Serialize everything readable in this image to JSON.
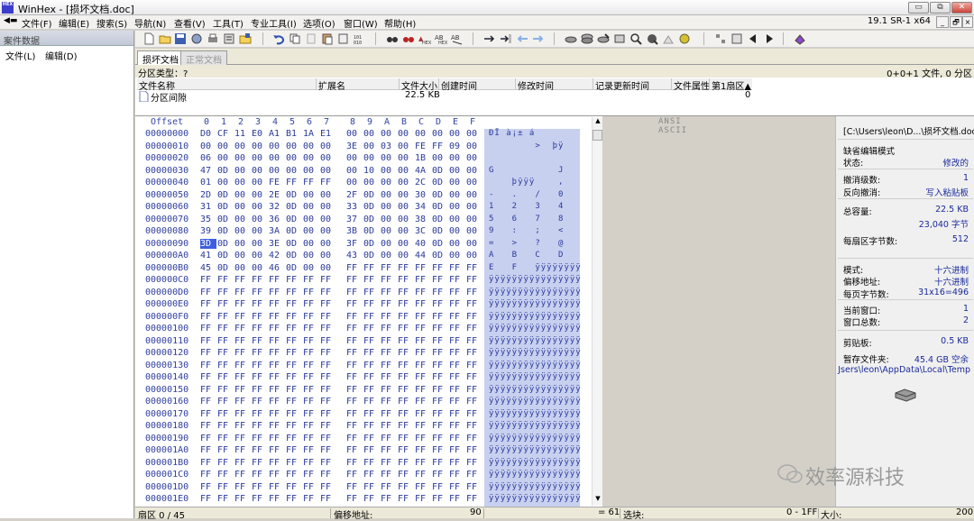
{
  "window": {
    "app_logo_text": "HEX",
    "title": "WinHex - [损坏文档.doc]",
    "version": "19.1 SR-1 x64",
    "controls": {
      "minimize": "▭",
      "restore": "⧉",
      "close": "✕"
    }
  },
  "menubar": {
    "items": [
      "文件(F)",
      "编辑(E)",
      "搜索(S)",
      "导航(N)",
      "查看(V)",
      "工具(T)",
      "专业工具(I)",
      "选项(O)",
      "窗口(W)",
      "帮助(H)"
    ],
    "mdi_controls": {
      "minimize": "_",
      "restore": "🗗",
      "close": "×"
    }
  },
  "left_pane": {
    "title": "案件数据",
    "menu": [
      "文件(L)",
      "编辑(D)"
    ]
  },
  "tabs": [
    {
      "label": "损坏文档",
      "active": true
    },
    {
      "label": "正常文档",
      "active": false
    }
  ],
  "info": {
    "partition_type": "分区类型：?",
    "file_summary": "0+0+1 文件, 0 分区"
  },
  "directory": {
    "columns": [
      "文件名称",
      "扩展名",
      "文件大小",
      "创建时间",
      "修改时间",
      "记录更新时间",
      "文件属性",
      "第1扇区▲"
    ],
    "rows": [
      {
        "name": "分区间隙",
        "ext": "",
        "size": "22.5 KB",
        "created": "",
        "modified": "",
        "updated": "",
        "attr": "",
        "sector": "0"
      }
    ]
  },
  "hex": {
    "offset_header": "Offset",
    "column_headers": [
      "0",
      "1",
      "2",
      "3",
      "4",
      "5",
      "6",
      "7",
      "8",
      "9",
      "A",
      "B",
      "C",
      "D",
      "E",
      "F"
    ],
    "ascii_header": "ANSI ASCII",
    "rows": [
      {
        "offset": "00000000",
        "bytes": [
          "D0",
          "CF",
          "11",
          "E0",
          "A1",
          "B1",
          "1A",
          "E1",
          "00",
          "00",
          "00",
          "00",
          "00",
          "00",
          "00",
          "00"
        ],
        "ascii": "ĐÏ à¡± á"
      },
      {
        "offset": "00000010",
        "bytes": [
          "00",
          "00",
          "00",
          "00",
          "00",
          "00",
          "00",
          "00",
          "3E",
          "00",
          "03",
          "00",
          "FE",
          "FF",
          "09",
          "00"
        ],
        "ascii": "        >  þÿ"
      },
      {
        "offset": "00000020",
        "bytes": [
          "06",
          "00",
          "00",
          "00",
          "00",
          "00",
          "00",
          "00",
          "00",
          "00",
          "00",
          "00",
          "1B",
          "00",
          "00",
          "00"
        ],
        "ascii": ""
      },
      {
        "offset": "00000030",
        "bytes": [
          "47",
          "0D",
          "00",
          "00",
          "00",
          "00",
          "00",
          "00",
          "00",
          "10",
          "00",
          "00",
          "4A",
          "0D",
          "00",
          "00"
        ],
        "ascii": "G           J"
      },
      {
        "offset": "00000040",
        "bytes": [
          "01",
          "00",
          "00",
          "00",
          "FE",
          "FF",
          "FF",
          "FF",
          "00",
          "00",
          "00",
          "00",
          "2C",
          "0D",
          "00",
          "00"
        ],
        "ascii": "    þÿÿÿ    ,"
      },
      {
        "offset": "00000050",
        "bytes": [
          "2D",
          "0D",
          "00",
          "00",
          "2E",
          "0D",
          "00",
          "00",
          "2F",
          "0D",
          "00",
          "00",
          "30",
          "0D",
          "00",
          "00"
        ],
        "ascii": "-   .   /   0"
      },
      {
        "offset": "00000060",
        "bytes": [
          "31",
          "0D",
          "00",
          "00",
          "32",
          "0D",
          "00",
          "00",
          "33",
          "0D",
          "00",
          "00",
          "34",
          "0D",
          "00",
          "00"
        ],
        "ascii": "1   2   3   4"
      },
      {
        "offset": "00000070",
        "bytes": [
          "35",
          "0D",
          "00",
          "00",
          "36",
          "0D",
          "00",
          "00",
          "37",
          "0D",
          "00",
          "00",
          "38",
          "0D",
          "00",
          "00"
        ],
        "ascii": "5   6   7   8"
      },
      {
        "offset": "00000080",
        "bytes": [
          "39",
          "0D",
          "00",
          "00",
          "3A",
          "0D",
          "00",
          "00",
          "3B",
          "0D",
          "00",
          "00",
          "3C",
          "0D",
          "00",
          "00"
        ],
        "ascii": "9   :   ;   <"
      },
      {
        "offset": "00000090",
        "bytes": [
          "3D",
          "0D",
          "00",
          "00",
          "3E",
          "0D",
          "00",
          "00",
          "3F",
          "0D",
          "00",
          "00",
          "40",
          "0D",
          "00",
          "00"
        ],
        "ascii": "=   >   ?   @"
      },
      {
        "offset": "000000A0",
        "bytes": [
          "41",
          "0D",
          "00",
          "00",
          "42",
          "0D",
          "00",
          "00",
          "43",
          "0D",
          "00",
          "00",
          "44",
          "0D",
          "00",
          "00"
        ],
        "ascii": "A   B   C   D"
      },
      {
        "offset": "000000B0",
        "bytes": [
          "45",
          "0D",
          "00",
          "00",
          "46",
          "0D",
          "00",
          "00",
          "FF",
          "FF",
          "FF",
          "FF",
          "FF",
          "FF",
          "FF",
          "FF"
        ],
        "ascii": "E   F   ÿÿÿÿÿÿÿÿ"
      },
      {
        "offset": "000000C0",
        "bytes": [
          "FF",
          "FF",
          "FF",
          "FF",
          "FF",
          "FF",
          "FF",
          "FF",
          "FF",
          "FF",
          "FF",
          "FF",
          "FF",
          "FF",
          "FF",
          "FF"
        ],
        "ascii": "ÿÿÿÿÿÿÿÿÿÿÿÿÿÿÿÿ"
      },
      {
        "offset": "000000D0",
        "bytes": [
          "FF",
          "FF",
          "FF",
          "FF",
          "FF",
          "FF",
          "FF",
          "FF",
          "FF",
          "FF",
          "FF",
          "FF",
          "FF",
          "FF",
          "FF",
          "FF"
        ],
        "ascii": "ÿÿÿÿÿÿÿÿÿÿÿÿÿÿÿÿ"
      },
      {
        "offset": "000000E0",
        "bytes": [
          "FF",
          "FF",
          "FF",
          "FF",
          "FF",
          "FF",
          "FF",
          "FF",
          "FF",
          "FF",
          "FF",
          "FF",
          "FF",
          "FF",
          "FF",
          "FF"
        ],
        "ascii": "ÿÿÿÿÿÿÿÿÿÿÿÿÿÿÿÿ"
      },
      {
        "offset": "000000F0",
        "bytes": [
          "FF",
          "FF",
          "FF",
          "FF",
          "FF",
          "FF",
          "FF",
          "FF",
          "FF",
          "FF",
          "FF",
          "FF",
          "FF",
          "FF",
          "FF",
          "FF"
        ],
        "ascii": "ÿÿÿÿÿÿÿÿÿÿÿÿÿÿÿÿ"
      },
      {
        "offset": "00000100",
        "bytes": [
          "FF",
          "FF",
          "FF",
          "FF",
          "FF",
          "FF",
          "FF",
          "FF",
          "FF",
          "FF",
          "FF",
          "FF",
          "FF",
          "FF",
          "FF",
          "FF"
        ],
        "ascii": "ÿÿÿÿÿÿÿÿÿÿÿÿÿÿÿÿ"
      },
      {
        "offset": "00000110",
        "bytes": [
          "FF",
          "FF",
          "FF",
          "FF",
          "FF",
          "FF",
          "FF",
          "FF",
          "FF",
          "FF",
          "FF",
          "FF",
          "FF",
          "FF",
          "FF",
          "FF"
        ],
        "ascii": "ÿÿÿÿÿÿÿÿÿÿÿÿÿÿÿÿ"
      },
      {
        "offset": "00000120",
        "bytes": [
          "FF",
          "FF",
          "FF",
          "FF",
          "FF",
          "FF",
          "FF",
          "FF",
          "FF",
          "FF",
          "FF",
          "FF",
          "FF",
          "FF",
          "FF",
          "FF"
        ],
        "ascii": "ÿÿÿÿÿÿÿÿÿÿÿÿÿÿÿÿ"
      },
      {
        "offset": "00000130",
        "bytes": [
          "FF",
          "FF",
          "FF",
          "FF",
          "FF",
          "FF",
          "FF",
          "FF",
          "FF",
          "FF",
          "FF",
          "FF",
          "FF",
          "FF",
          "FF",
          "FF"
        ],
        "ascii": "ÿÿÿÿÿÿÿÿÿÿÿÿÿÿÿÿ"
      },
      {
        "offset": "00000140",
        "bytes": [
          "FF",
          "FF",
          "FF",
          "FF",
          "FF",
          "FF",
          "FF",
          "FF",
          "FF",
          "FF",
          "FF",
          "FF",
          "FF",
          "FF",
          "FF",
          "FF"
        ],
        "ascii": "ÿÿÿÿÿÿÿÿÿÿÿÿÿÿÿÿ"
      },
      {
        "offset": "00000150",
        "bytes": [
          "FF",
          "FF",
          "FF",
          "FF",
          "FF",
          "FF",
          "FF",
          "FF",
          "FF",
          "FF",
          "FF",
          "FF",
          "FF",
          "FF",
          "FF",
          "FF"
        ],
        "ascii": "ÿÿÿÿÿÿÿÿÿÿÿÿÿÿÿÿ"
      },
      {
        "offset": "00000160",
        "bytes": [
          "FF",
          "FF",
          "FF",
          "FF",
          "FF",
          "FF",
          "FF",
          "FF",
          "FF",
          "FF",
          "FF",
          "FF",
          "FF",
          "FF",
          "FF",
          "FF"
        ],
        "ascii": "ÿÿÿÿÿÿÿÿÿÿÿÿÿÿÿÿ"
      },
      {
        "offset": "00000170",
        "bytes": [
          "FF",
          "FF",
          "FF",
          "FF",
          "FF",
          "FF",
          "FF",
          "FF",
          "FF",
          "FF",
          "FF",
          "FF",
          "FF",
          "FF",
          "FF",
          "FF"
        ],
        "ascii": "ÿÿÿÿÿÿÿÿÿÿÿÿÿÿÿÿ"
      },
      {
        "offset": "00000180",
        "bytes": [
          "FF",
          "FF",
          "FF",
          "FF",
          "FF",
          "FF",
          "FF",
          "FF",
          "FF",
          "FF",
          "FF",
          "FF",
          "FF",
          "FF",
          "FF",
          "FF"
        ],
        "ascii": "ÿÿÿÿÿÿÿÿÿÿÿÿÿÿÿÿ"
      },
      {
        "offset": "00000190",
        "bytes": [
          "FF",
          "FF",
          "FF",
          "FF",
          "FF",
          "FF",
          "FF",
          "FF",
          "FF",
          "FF",
          "FF",
          "FF",
          "FF",
          "FF",
          "FF",
          "FF"
        ],
        "ascii": "ÿÿÿÿÿÿÿÿÿÿÿÿÿÿÿÿ"
      },
      {
        "offset": "000001A0",
        "bytes": [
          "FF",
          "FF",
          "FF",
          "FF",
          "FF",
          "FF",
          "FF",
          "FF",
          "FF",
          "FF",
          "FF",
          "FF",
          "FF",
          "FF",
          "FF",
          "FF"
        ],
        "ascii": "ÿÿÿÿÿÿÿÿÿÿÿÿÿÿÿÿ"
      },
      {
        "offset": "000001B0",
        "bytes": [
          "FF",
          "FF",
          "FF",
          "FF",
          "FF",
          "FF",
          "FF",
          "FF",
          "FF",
          "FF",
          "FF",
          "FF",
          "FF",
          "FF",
          "FF",
          "FF"
        ],
        "ascii": "ÿÿÿÿÿÿÿÿÿÿÿÿÿÿÿÿ"
      },
      {
        "offset": "000001C0",
        "bytes": [
          "FF",
          "FF",
          "FF",
          "FF",
          "FF",
          "FF",
          "FF",
          "FF",
          "FF",
          "FF",
          "FF",
          "FF",
          "FF",
          "FF",
          "FF",
          "FF"
        ],
        "ascii": "ÿÿÿÿÿÿÿÿÿÿÿÿÿÿÿÿ"
      },
      {
        "offset": "000001D0",
        "bytes": [
          "FF",
          "FF",
          "FF",
          "FF",
          "FF",
          "FF",
          "FF",
          "FF",
          "FF",
          "FF",
          "FF",
          "FF",
          "FF",
          "FF",
          "FF",
          "FF"
        ],
        "ascii": "ÿÿÿÿÿÿÿÿÿÿÿÿÿÿÿÿ"
      },
      {
        "offset": "000001E0",
        "bytes": [
          "FF",
          "FF",
          "FF",
          "FF",
          "FF",
          "FF",
          "FF",
          "FF",
          "FF",
          "FF",
          "FF",
          "FF",
          "FF",
          "FF",
          "FF",
          "FF"
        ],
        "ascii": "ÿÿÿÿÿÿÿÿÿÿÿÿÿÿÿÿ"
      }
    ]
  },
  "right_pane": {
    "path": "[C:\\Users\\leon\\D...\\损坏文档.doc]",
    "items": [
      {
        "label": "缺省编辑模式",
        "value": ""
      },
      {
        "label": "状态:",
        "value": "修改的"
      },
      {
        "label": "撤消级数:",
        "value": "1"
      },
      {
        "label": "反向撤消:",
        "value": "写入粘贴板"
      },
      {
        "label": "总容量:",
        "value": "22.5 KB"
      },
      {
        "label": "",
        "value": "23,040 字节"
      },
      {
        "label": "每扇区字节数:",
        "value": "512"
      },
      {
        "label": "模式:",
        "value": "十六进制"
      },
      {
        "label": "偏移地址:",
        "value": "十六进制"
      },
      {
        "label": "每页字节数:",
        "value": "31x16=496"
      },
      {
        "label": "当前窗口:",
        "value": "1"
      },
      {
        "label": "窗口总数:",
        "value": "2"
      },
      {
        "label": "剪贴板:",
        "value": "0.5 KB"
      },
      {
        "label": "暂存文件夹:",
        "value": "45.4 GB 空余"
      },
      {
        "label": "",
        "value": "Jsers\\leon\\AppData\\Local\\Temp"
      }
    ]
  },
  "statusbar": {
    "sector": "扇区 0 / 45",
    "offset_label": "偏移地址:",
    "offset_value": "90",
    "eq_value": "= 61",
    "block_label": "选块:",
    "block_value": "0 - 1FF",
    "size_label": "大小:",
    "size_value": "200"
  },
  "watermark": "效率源科技",
  "colors": {
    "hex_text": "#2a3a9a",
    "ascii_bg": "#c8d0f0",
    "selection": "#3d5ee0"
  }
}
